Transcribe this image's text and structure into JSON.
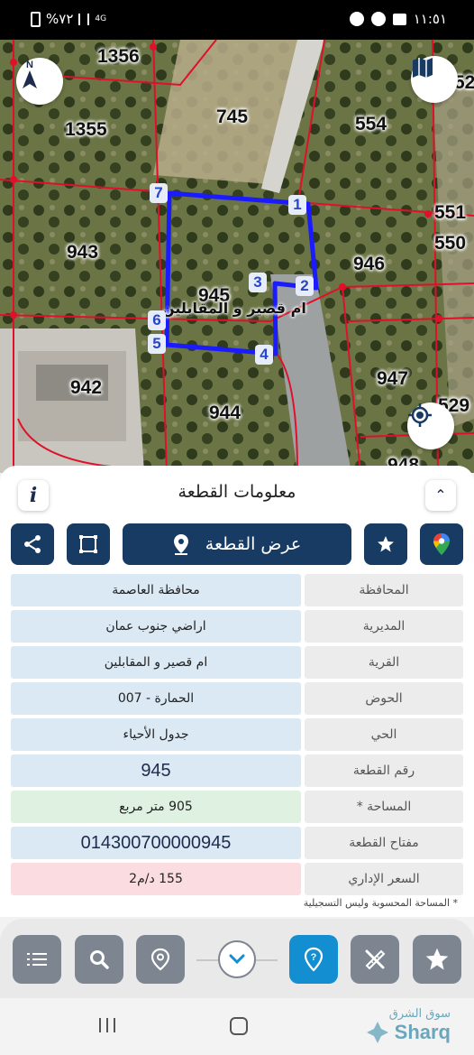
{
  "status_bar": {
    "battery_text": "%٧٢",
    "network": "4G",
    "time": "١١:٥١"
  },
  "map": {
    "compass_label": "N",
    "plot_numbers": [
      "1356",
      "1355",
      "745",
      "554",
      "551",
      "550",
      "943",
      "946",
      "945",
      "942",
      "944",
      "947",
      "948",
      "52",
      "529"
    ],
    "village_label": "ام قصير و المقابلين",
    "vertices": [
      "1",
      "2",
      "3",
      "4",
      "5",
      "6",
      "7"
    ],
    "boundary_color": "#1b1bff",
    "parcel_line_color": "#e0102a"
  },
  "sheet": {
    "title": "معلومات القطعة",
    "info_icon": "i",
    "show_parcel_label": "عرض القطعة",
    "rows": [
      {
        "label": "المحافظة",
        "value": "محافظة العاصمة"
      },
      {
        "label": "المديرية",
        "value": "اراضي جنوب عمان"
      },
      {
        "label": "القرية",
        "value": "ام قصير و المقابلين"
      },
      {
        "label": "الحوض",
        "value": "الحمارة - 007"
      },
      {
        "label": "الحي",
        "value": "جدول الأحياء"
      },
      {
        "label": "رقم القطعة",
        "value": "945"
      },
      {
        "label": "المساحة *",
        "value": "905  متر مربع"
      },
      {
        "label": "مفتاح القطعة",
        "value": "014300700000945"
      },
      {
        "label": "السعر الإداري",
        "value": "155 د/م2"
      }
    ],
    "footnote": "* المساحة المحسوبة وليس التسجيلية"
  },
  "watermark": {
    "arabic": "سوق الشرق",
    "english": "Sharq"
  },
  "colors": {
    "primary_dark": "#173b63",
    "toolbar_active": "#138fd1",
    "row_blue": "#dbe9f4",
    "row_green": "#dff2e2",
    "row_red": "#fbdde1"
  }
}
